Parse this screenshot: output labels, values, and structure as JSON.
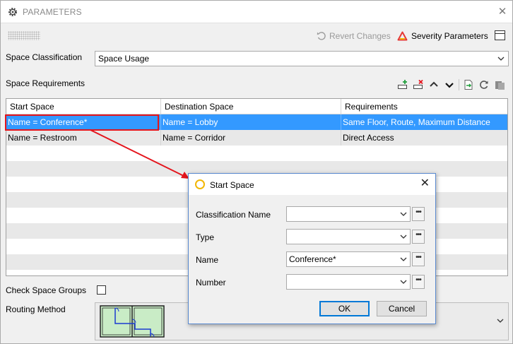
{
  "window": {
    "title": "PARAMETERS",
    "close_glyph": "✕"
  },
  "toolbar_top": {
    "revert_label": "Revert Changes",
    "severity_label": "Severity Parameters"
  },
  "space_classification": {
    "label": "Space Classification",
    "value": "Space Usage"
  },
  "space_requirements": {
    "label": "Space Requirements",
    "columns": [
      "Start Space",
      "Destination Space",
      "Requirements"
    ],
    "rows": [
      {
        "start": "Name = Conference*",
        "destination": "Name = Lobby",
        "requirements": "Same Floor, Route, Maximum Distance",
        "selected": true
      },
      {
        "start": "Name = Restroom",
        "destination": "Name = Corridor",
        "requirements": "Direct Access",
        "selected": false
      }
    ]
  },
  "check_space_groups": {
    "label": "Check Space Groups",
    "checked": false
  },
  "routing_method": {
    "label": "Routing Method"
  },
  "dialog": {
    "title": "Start Space",
    "close_glyph": "✕",
    "fields": [
      {
        "label": "Classification Name",
        "value": ""
      },
      {
        "label": "Type",
        "value": ""
      },
      {
        "label": "Name",
        "value": "Conference*"
      },
      {
        "label": "Number",
        "value": ""
      }
    ],
    "ok_label": "OK",
    "cancel_label": "Cancel"
  },
  "colors": {
    "selection": "#3399ff",
    "annotation": "#e4141c",
    "severity_icon": "#e53935",
    "dialog_icon": "#f2b705"
  },
  "icons": [
    "gear-icon",
    "revert-icon",
    "severity-triangle-icon",
    "panel-icon",
    "add-row-icon",
    "delete-row-icon",
    "move-up-icon",
    "move-down-icon",
    "export-icon",
    "refresh-icon",
    "paste-icon",
    "chevron-down-icon",
    "ellipsis-icon",
    "routing-thumbnail-icon"
  ]
}
